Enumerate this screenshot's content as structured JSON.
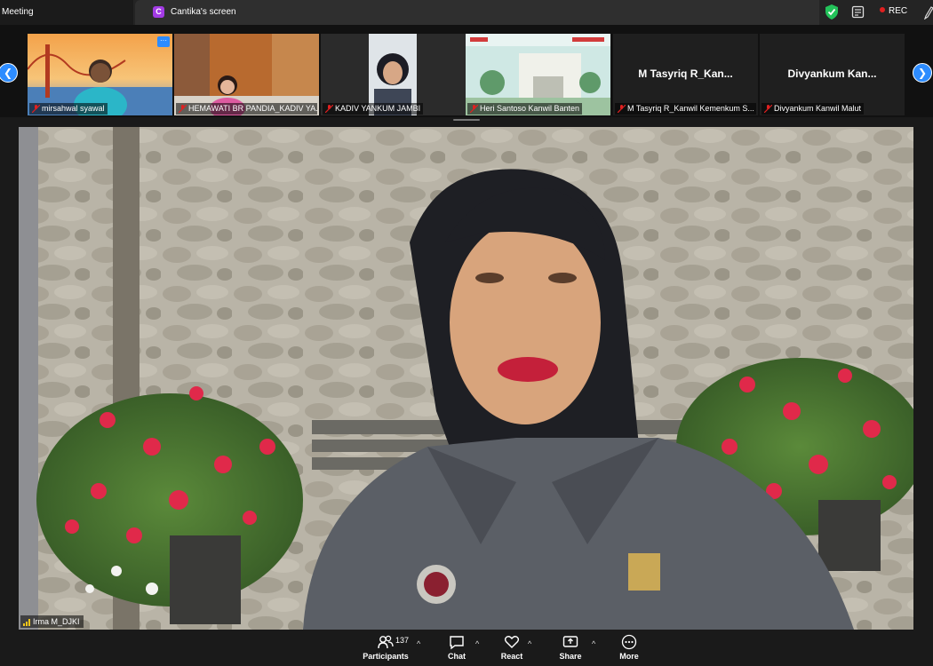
{
  "window": {
    "title": "Meeting"
  },
  "share_tab": {
    "badge": "C",
    "label": "Cantika's screen"
  },
  "status": {
    "rec_label": "REC",
    "shield_icon": "shield-check-icon",
    "shield_color": "#23c35a"
  },
  "participants_strip": {
    "tiles": [
      {
        "name": "mirsahwal syawal",
        "type": "video"
      },
      {
        "name": "HEMAWATI BR PANDIA_KADIV YA...",
        "type": "video"
      },
      {
        "name": "KADIV YANKUM JAMBI",
        "type": "video"
      },
      {
        "name": "Heri Santoso Kanwil Banten",
        "type": "video"
      },
      {
        "name": "M Tasyriq R_Kanwil Kemenkum S...",
        "type": "name",
        "display": "M Tasyriq R_Kan..."
      },
      {
        "name": "Divyankum Kanwil Malut",
        "type": "name",
        "display": "Divyankum  Kan..."
      }
    ],
    "more_badge": "···"
  },
  "main_speaker": {
    "name": "Irma M_DJKI"
  },
  "toolbar": {
    "participants_label": "Participants",
    "participants_count": "137",
    "chat_label": "Chat",
    "react_label": "React",
    "share_label": "Share",
    "more_label": "More"
  },
  "colors": {
    "accent": "#2d8cff",
    "rec_dot": "#e02020",
    "muted": "#e02020",
    "tab_badge": "#a33be5"
  }
}
